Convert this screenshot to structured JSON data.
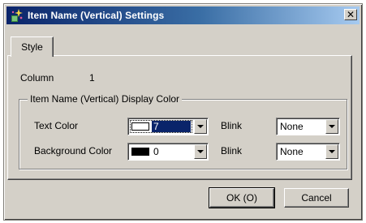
{
  "window": {
    "title": "Item Name (Vertical) Settings",
    "close_glyph": "✕"
  },
  "tabs": [
    {
      "label": "Style",
      "selected": true
    }
  ],
  "column": {
    "label": "Column",
    "value": "1"
  },
  "display_color_group": {
    "legend": "Item Name (Vertical) Display Color",
    "text_color": {
      "label": "Text Color",
      "value": "7",
      "swatch_color": "#ffffff",
      "blink_label": "Blink",
      "blink_value": "None"
    },
    "background_color": {
      "label": "Background Color",
      "value": "0",
      "swatch_color": "#000000",
      "blink_label": "Blink",
      "blink_value": "None"
    }
  },
  "buttons": {
    "ok": "OK (O)",
    "cancel": "Cancel"
  },
  "colors": {
    "title_bar_start": "#0a246a",
    "title_bar_end": "#a6caf0",
    "dialog_face": "#d4d0c8",
    "selection": "#0a246a"
  },
  "icons": {
    "title": "settings-sparkle-icon",
    "dropdown": "chevron-down-icon",
    "close": "close-icon"
  }
}
